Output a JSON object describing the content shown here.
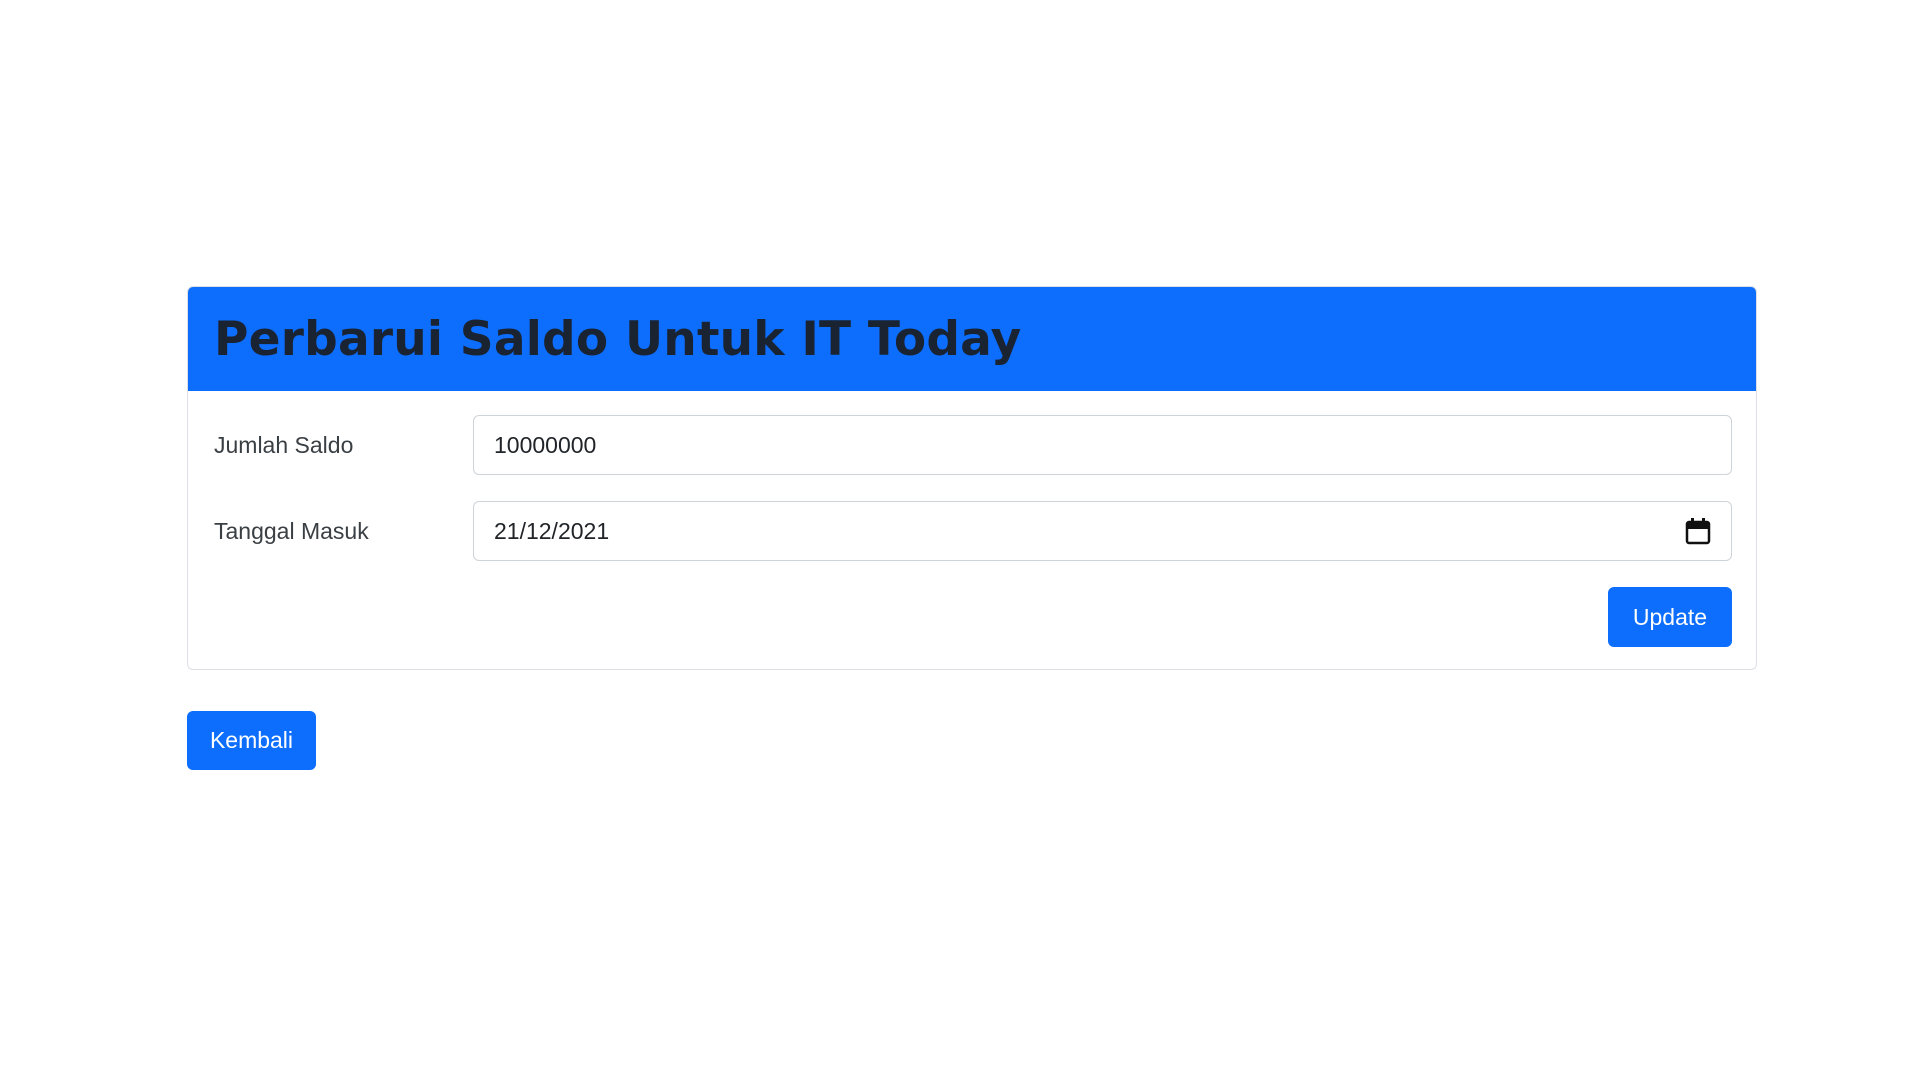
{
  "card": {
    "title": "Perbarui Saldo Untuk IT Today"
  },
  "form": {
    "saldo": {
      "label": "Jumlah Saldo",
      "value": "10000000"
    },
    "tanggal": {
      "label": "Tanggal Masuk",
      "value": "21/12/2021",
      "icon": "calendar-icon"
    },
    "update_label": "Update"
  },
  "back_label": "Kembali",
  "colors": {
    "primary": "#0d6efd",
    "title_text": "#1a2332",
    "button_text": "#ffffff"
  }
}
